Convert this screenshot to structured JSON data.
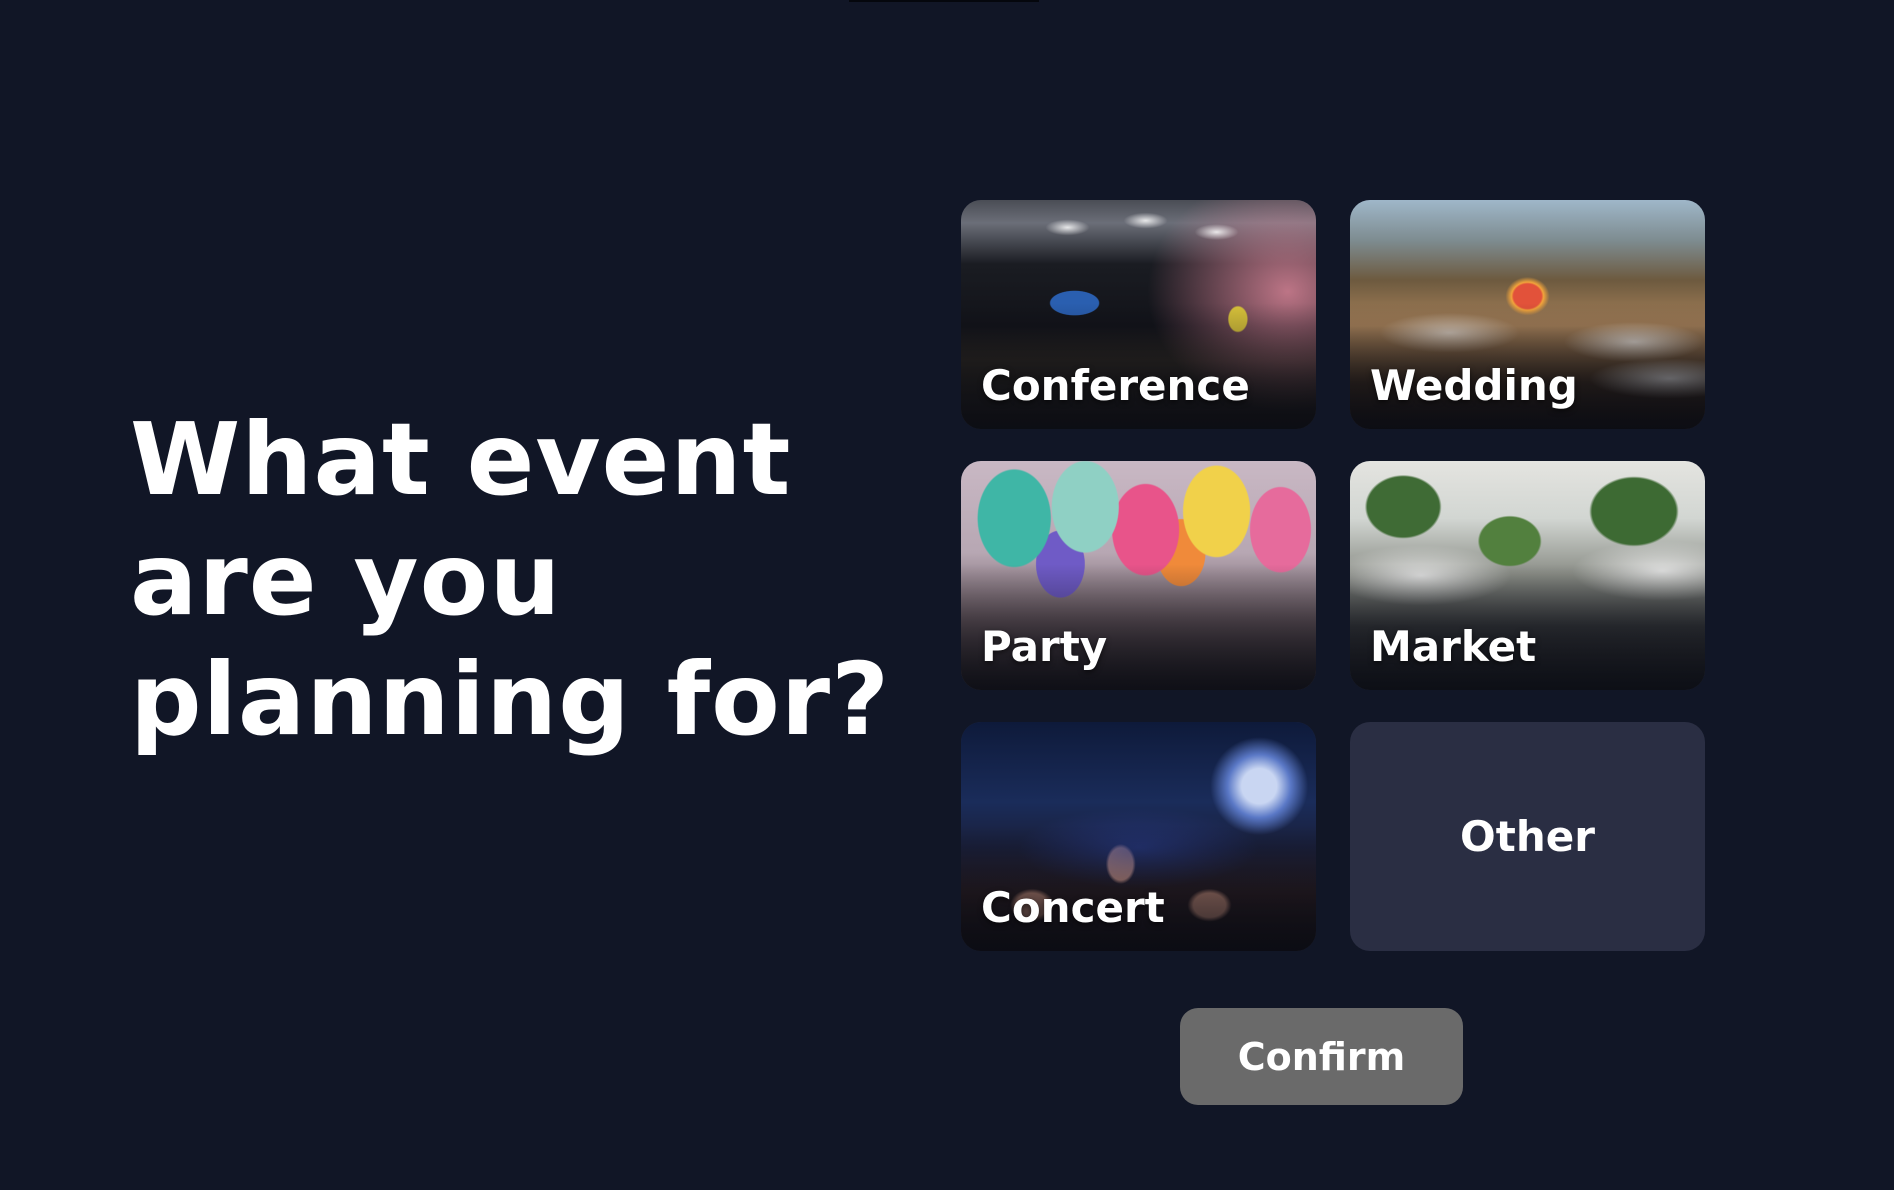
{
  "heading": {
    "line1": "What event",
    "line2": "are you",
    "line3": "planning for?"
  },
  "options": [
    {
      "label": "Conference",
      "image": "conference-photo"
    },
    {
      "label": "Wedding",
      "image": "wedding-photo"
    },
    {
      "label": "Party",
      "image": "party-balloons-photo"
    },
    {
      "label": "Market",
      "image": "street-market-photo"
    },
    {
      "label": "Concert",
      "image": "concert-crowd-photo"
    },
    {
      "label": "Other"
    }
  ],
  "confirm_label": "Confirm",
  "colors": {
    "background": "#111626",
    "card_other": "#2a2e43",
    "confirm_button": "#6a6a6a",
    "text": "#ffffff"
  }
}
